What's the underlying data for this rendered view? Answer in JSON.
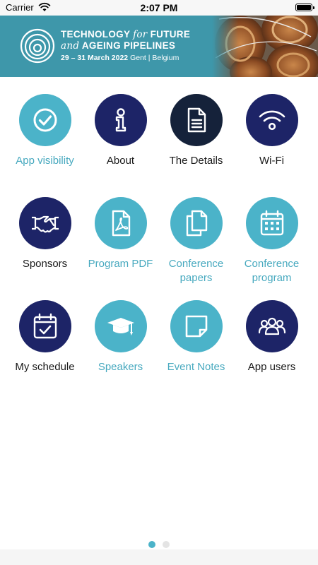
{
  "status_bar": {
    "carrier": "Carrier",
    "time": "2:07 PM"
  },
  "banner": {
    "title_line1_a": "TECHNOLOGY ",
    "title_line1_b": "for",
    "title_line1_c": " FUTURE",
    "title_line2_a": "and",
    "title_line2_b": " AGEING PIPELINES",
    "dates": "29 – 31 March 2022",
    "location": " Gent | Belgium"
  },
  "colors": {
    "navy": "#1d2467",
    "teal": "#4bb3c9",
    "banner": "#3e97aa"
  },
  "grid": {
    "items": [
      {
        "label": "App visibility",
        "icon": "checkmark-icon",
        "style": "teal"
      },
      {
        "label": "About",
        "icon": "info-icon",
        "style": "navy"
      },
      {
        "label": "The Details",
        "icon": "document-icon",
        "style": "navy"
      },
      {
        "label": "Wi-Fi",
        "icon": "wifi-icon",
        "style": "navy"
      },
      {
        "label": "Sponsors",
        "icon": "handshake-icon",
        "style": "navy"
      },
      {
        "label": "Program PDF",
        "icon": "pdf-icon",
        "style": "teal"
      },
      {
        "label": "Conference papers",
        "icon": "copy-icon",
        "style": "teal"
      },
      {
        "label": "Conference program",
        "icon": "calendar-icon",
        "style": "teal"
      },
      {
        "label": "My schedule",
        "icon": "calendar-check-icon",
        "style": "navy"
      },
      {
        "label": "Speakers",
        "icon": "graduation-cap-icon",
        "style": "teal"
      },
      {
        "label": "Event Notes",
        "icon": "note-icon",
        "style": "teal"
      },
      {
        "label": "App users",
        "icon": "users-icon",
        "style": "navy"
      }
    ]
  },
  "pagination": {
    "pages": 2,
    "active": 1
  }
}
